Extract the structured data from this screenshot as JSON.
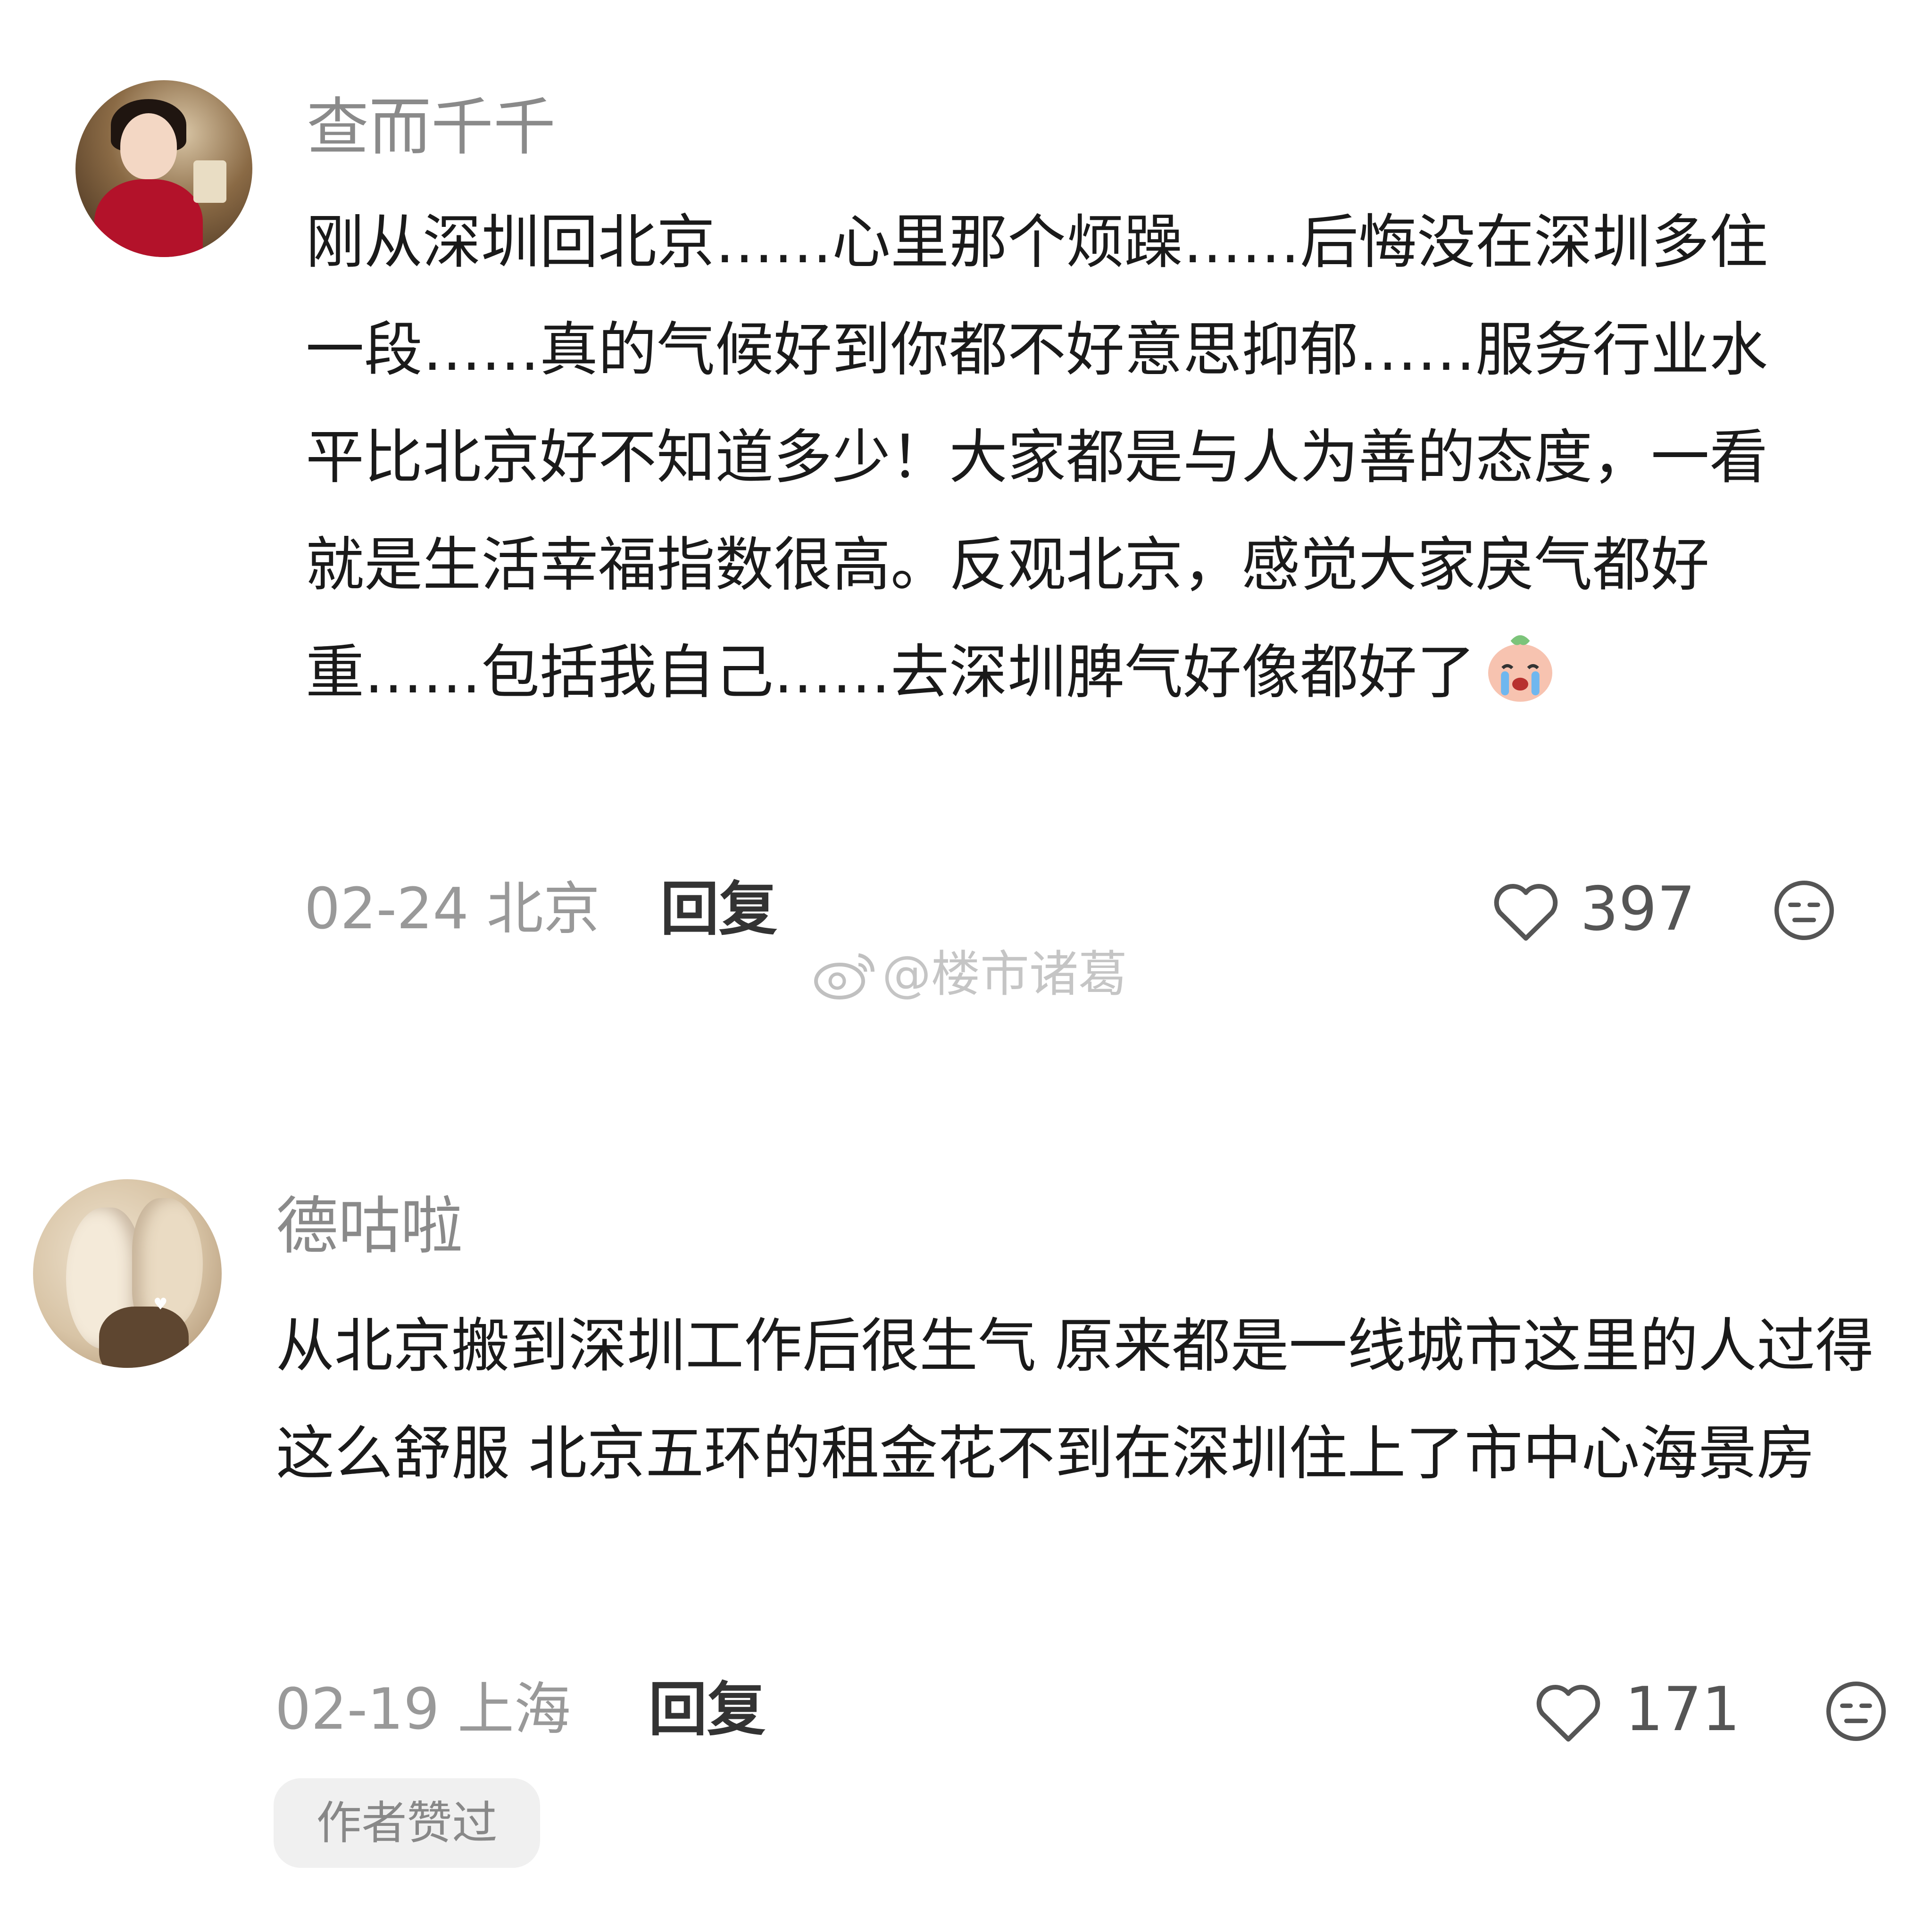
{
  "comments": [
    {
      "username": "查而千千",
      "text": "刚从深圳回北京……心里那个烦躁……后悔没在深圳多住一段……真的气候好到你都不好意思抑郁……服务行业水平比北京好不知道多少！大家都是与人为善的态度，一看就是生活幸福指数很高。反观北京，感觉大家戾气都好重……包括我自己……去深圳脾气好像都好了",
      "emoji": "crying-face-emoji",
      "date": "02-24",
      "location": "北京",
      "reply_label": "回复",
      "likes": "397"
    },
    {
      "username": "德咕啦",
      "text": "从北京搬到深圳工作后很生气 原来都是一线城市这里的人过得这么舒服  北京五环的租金花不到在深圳住上了市中心海景房",
      "date": "02-19",
      "location": "上海",
      "reply_label": "回复",
      "likes": "171",
      "badge": "作者赞过"
    }
  ],
  "watermark": "@楼市诸葛",
  "icons": {
    "like": "heart-outline-icon",
    "dislike": "unamused-face-icon",
    "watermark": "weibo-logo-icon"
  }
}
